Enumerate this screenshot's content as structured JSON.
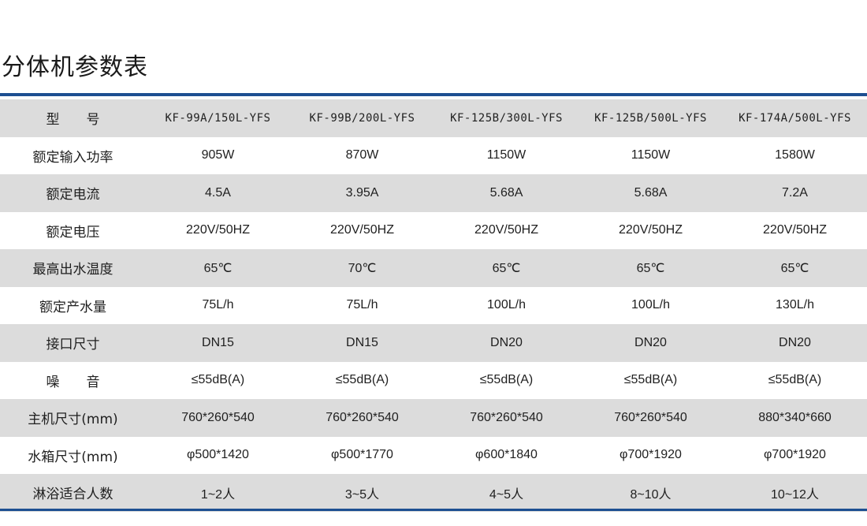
{
  "title": "分体机参数表",
  "colors": {
    "accent": "#1d4f91",
    "row_shade": "#dcdcdc"
  },
  "rows": [
    {
      "label": "型　　号",
      "values": [
        "KF-99A/150L-YFS",
        "KF-99B/200L-YFS",
        "KF-125B/300L-YFS",
        "KF-125B/500L-YFS",
        "KF-174A/500L-YFS"
      ]
    },
    {
      "label": "额定输入功率",
      "values": [
        "905W",
        "870W",
        "1150W",
        "1150W",
        "1580W"
      ]
    },
    {
      "label": "额定电流",
      "values": [
        "4.5A",
        "3.95A",
        "5.68A",
        "5.68A",
        "7.2A"
      ]
    },
    {
      "label": "额定电压",
      "values": [
        "220V/50HZ",
        "220V/50HZ",
        "220V/50HZ",
        "220V/50HZ",
        "220V/50HZ"
      ]
    },
    {
      "label": "最高出水温度",
      "values": [
        "65℃",
        "70℃",
        "65℃",
        "65℃",
        "65℃"
      ]
    },
    {
      "label": "额定产水量",
      "values": [
        "75L/h",
        "75L/h",
        "100L/h",
        "100L/h",
        "130L/h"
      ]
    },
    {
      "label": "接口尺寸",
      "values": [
        "DN15",
        "DN15",
        "DN20",
        "DN20",
        "DN20"
      ]
    },
    {
      "label": "噪　　音",
      "values": [
        "≤55dB(A)",
        "≤55dB(A)",
        "≤55dB(A)",
        "≤55dB(A)",
        "≤55dB(A)"
      ]
    },
    {
      "label": "主机尺寸(mm)",
      "values": [
        "760*260*540",
        "760*260*540",
        "760*260*540",
        "760*260*540",
        "880*340*660"
      ]
    },
    {
      "label": "水箱尺寸(mm)",
      "values": [
        "φ500*1420",
        "φ500*1770",
        "φ600*1840",
        "φ700*1920",
        "φ700*1920"
      ]
    },
    {
      "label": "淋浴适合人数",
      "values": [
        "1~2人",
        "3~5人",
        "4~5人",
        "8~10人",
        "10~12人"
      ]
    }
  ]
}
